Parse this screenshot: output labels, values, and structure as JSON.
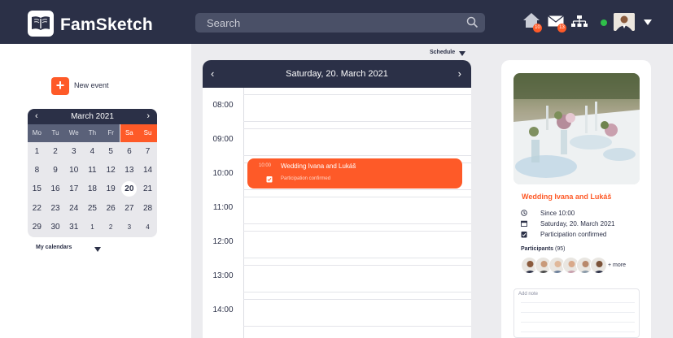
{
  "app": {
    "title": "FamSketch"
  },
  "search": {
    "placeholder": "Search"
  },
  "header": {
    "home_badge": "10",
    "mail_badge": "13",
    "icons": [
      "home-icon",
      "mail-icon",
      "hierarchy-icon",
      "chevron-down-icon"
    ],
    "online_color": "#2fbf4a"
  },
  "colors": {
    "navy": "#2b3047",
    "accent": "#fe5a28"
  },
  "sidebar": {
    "new_event_label": "New event",
    "new_event_plus": "+",
    "my_calendars": "My calendars"
  },
  "mini_calendar": {
    "month": "March 2021",
    "prev": "‹",
    "next": "›",
    "weekdays": [
      "Mo",
      "Tu",
      "We",
      "Th",
      "Fr",
      "Sa",
      "Su"
    ],
    "weeks": [
      [
        "1",
        "2",
        "3",
        "4",
        "5",
        "6",
        "7"
      ],
      [
        "8",
        "9",
        "10",
        "11",
        "12",
        "13",
        "14"
      ],
      [
        "15",
        "16",
        "17",
        "18",
        "19",
        "20",
        "21"
      ],
      [
        "22",
        "23",
        "24",
        "25",
        "26",
        "27",
        "28"
      ],
      [
        "29",
        "30",
        "31",
        "1",
        "2",
        "3",
        "4"
      ]
    ],
    "selected": "20"
  },
  "schedule": {
    "view_label": "Schedule",
    "date_title": "Saturday, 20. March 2021",
    "prev": "‹",
    "next": "›",
    "hours": [
      "08:00",
      "09:00",
      "10:00",
      "11:00",
      "12:00",
      "13:00",
      "14:00"
    ],
    "event": {
      "time": "10:00",
      "title": "Wedding Ivana and Lukáš",
      "status": "Participation confirmed"
    }
  },
  "detail": {
    "title": "Wedding Ivana and Lukáš",
    "since": "Since 10:00",
    "date": "Saturday, 20. March 2021",
    "status": "Participation confirmed",
    "participants_label": "Participants",
    "participants_count": "(95)",
    "more": "+ more",
    "note_placeholder": "Add note"
  }
}
